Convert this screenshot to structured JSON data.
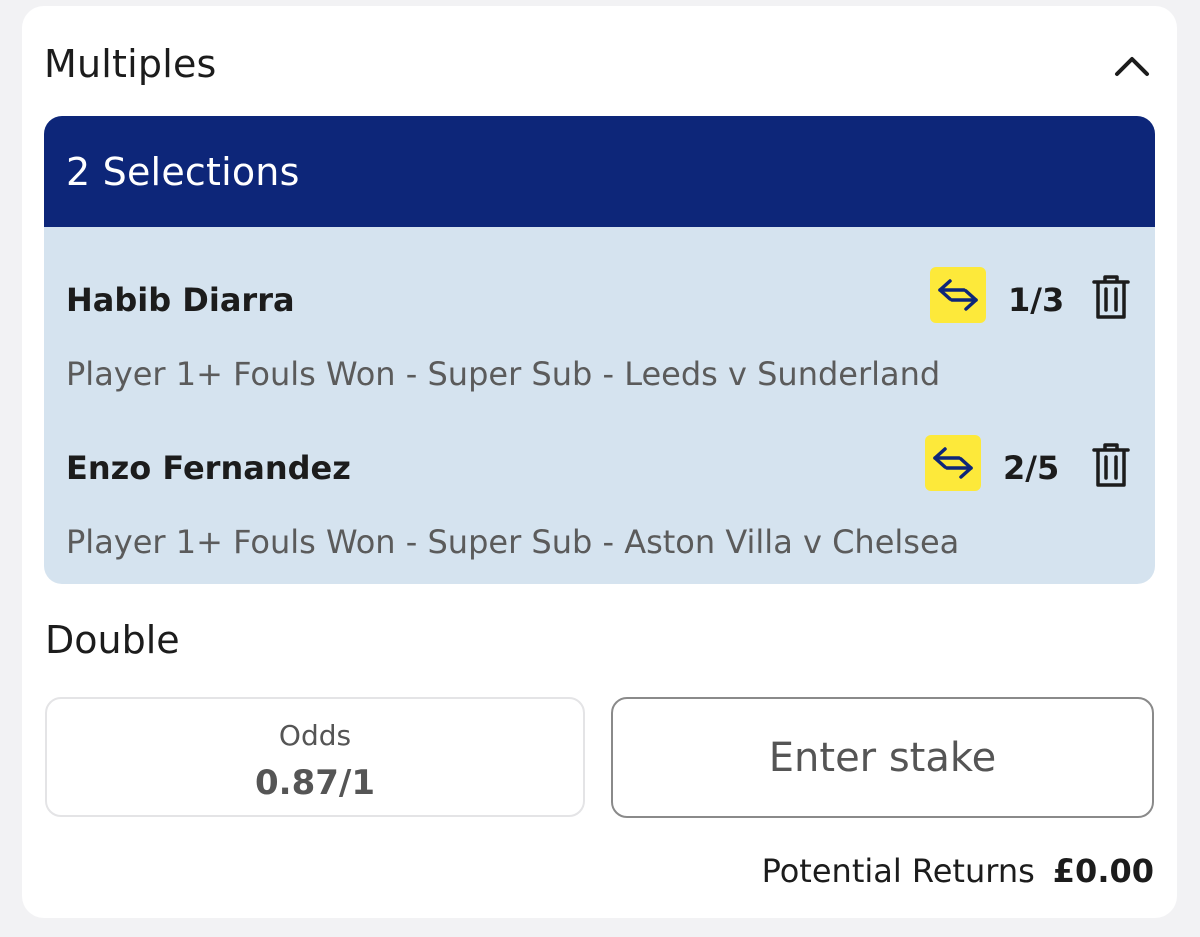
{
  "header": {
    "title": "Multiples"
  },
  "selections": {
    "heading": "2 Selections",
    "items": [
      {
        "name": "Habib Diarra",
        "odds": "1/3",
        "description": "Player 1+ Fouls Won - Super Sub - Leeds v Sunderland"
      },
      {
        "name": "Enzo Fernandez",
        "odds": "2/5",
        "description": "Player 1+ Fouls Won - Super Sub - Aston Villa v Chelsea"
      }
    ]
  },
  "double": {
    "title": "Double",
    "odds_label": "Odds",
    "odds_value": "0.87/1",
    "stake_placeholder": "Enter stake",
    "returns_label": "Potential Returns",
    "returns_value": "£0.00"
  },
  "icons": {
    "collapse": "chevron-up-icon",
    "swap": "swap-arrows-icon",
    "delete": "trash-icon"
  },
  "colors": {
    "selections_header_bg": "#0d2679",
    "selections_body_bg": "#d5e3ef",
    "swap_badge_bg": "#fde93a"
  }
}
